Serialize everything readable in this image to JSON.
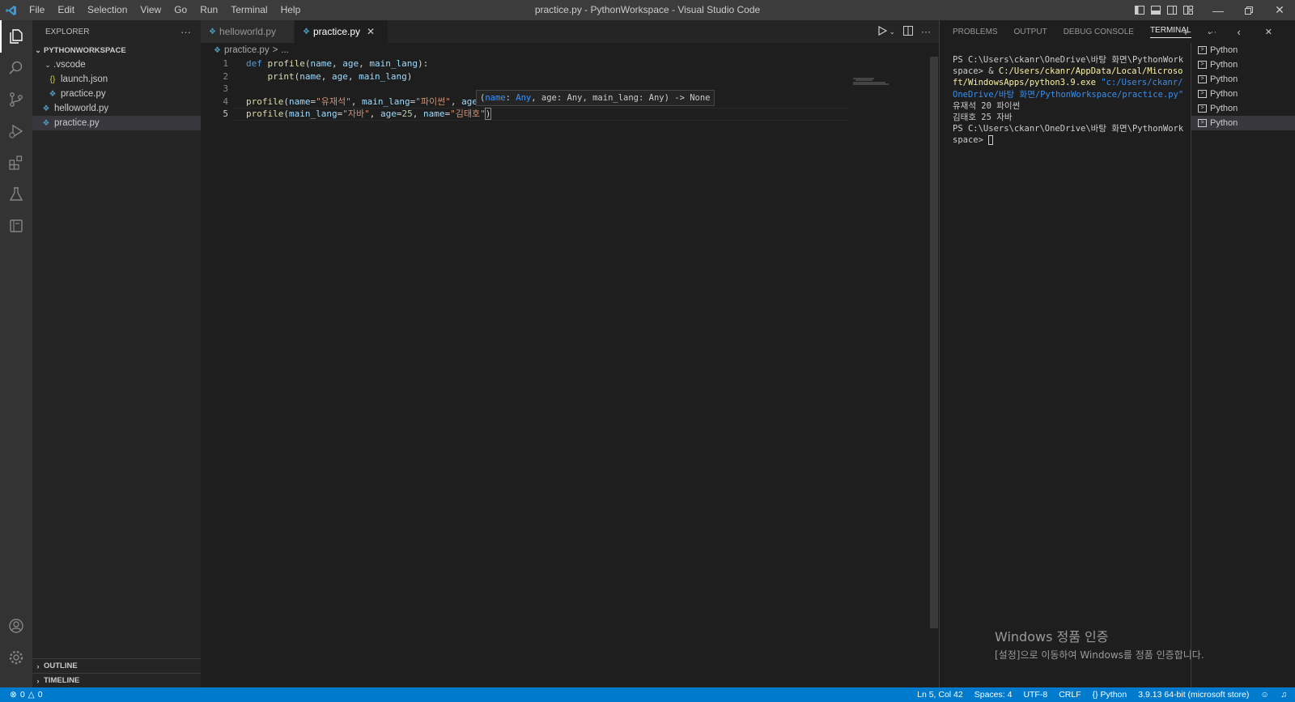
{
  "window": {
    "title": "practice.py - PythonWorkspace - Visual Studio Code"
  },
  "menu": [
    "File",
    "Edit",
    "Selection",
    "View",
    "Go",
    "Run",
    "Terminal",
    "Help"
  ],
  "explorer": {
    "header": "EXPLORER",
    "more": "···",
    "root": "PYTHONWORKSPACE",
    "folder_vscode": ".vscode",
    "launch_json": "launch.json",
    "practice_nested": "practice.py",
    "helloworld": "helloworld.py",
    "practice": "practice.py",
    "outline": "OUTLINE",
    "timeline": "TIMELINE"
  },
  "tabs": [
    {
      "label": "helloworld.py"
    },
    {
      "label": "practice.py"
    }
  ],
  "breadcrumb": {
    "file": "practice.py",
    "sep": ">",
    "more": "..."
  },
  "code": {
    "lines": [
      "1",
      "2",
      "3",
      "4",
      "5"
    ],
    "l1": {
      "def": "def ",
      "fn": "profile",
      "p1": "(",
      "a": "name",
      "c1": ", ",
      "b": "age",
      "c2": ", ",
      "c": "main_lang",
      "p2": "):"
    },
    "l2": {
      "ind": "    ",
      "fn": "print",
      "p1": "(",
      "a": "name",
      "c1": ", ",
      "b": "age",
      "c2": ", ",
      "c": "main_lang",
      "p2": ")"
    },
    "l4": {
      "fn": "profile",
      "p1": "(",
      "a": "name",
      "e1": "=",
      "s1": "\"유재석\"",
      "c1": ", ",
      "b": "main_lang",
      "e2": "=",
      "s2": "\"파이썬\"",
      "c2": ", ",
      "c": "age"
    },
    "l5": {
      "fn": "profile",
      "p1": "(",
      "a": "main_lang",
      "e1": "=",
      "s1": "\"자바\"",
      "c1": ", ",
      "b": "age",
      "e2": "=",
      "n": "25",
      "c2": ", ",
      "c": "name",
      "e3": "=",
      "s2": "\"김태호\"",
      "p2": ")"
    }
  },
  "hint": {
    "open": "(",
    "name": "name",
    "sep1": ": ",
    "any1": "Any",
    "rest": ", age: Any, main_lang: Any) -> None"
  },
  "panel": {
    "tabs": [
      "PROBLEMS",
      "OUTPUT",
      "DEBUG CONSOLE",
      "TERMINAL"
    ],
    "more": "···",
    "terminal": {
      "l1": "PS C:\\Users\\ckanr\\OneDrive\\바탕 화면\\PythonWorkspace> & ",
      "exe": "C:/Users/ckanr/AppData/Local/Microsoft/WindowsApps/python3.9.exe",
      "space": " ",
      "arg": "\"c:/Users/ckanr/OneDrive/바탕 화면/PythonWorkspace/practice.py\"",
      "out1": "유재석 20 파이썬",
      "out2": "김태호 25 자바",
      "prompt": "PS C:\\Users\\ckanr\\OneDrive\\바탕 화면\\PythonWorkspace> "
    },
    "terminal_list": [
      "Python",
      "Python",
      "Python",
      "Python",
      "Python",
      "Python"
    ]
  },
  "watermark": {
    "title": "Windows 정품 인증",
    "sub": "[설정]으로 이동하여 Windows를 정품 인증합니다."
  },
  "status": {
    "errors": "0",
    "warnings": "0",
    "position": "Ln 5, Col 42",
    "spaces": "Spaces: 4",
    "encoding": "UTF-8",
    "eol": "CRLF",
    "language": "Python",
    "interpreter": "3.9.13 64-bit (microsoft store)"
  },
  "colors": {
    "accent": "#007acc",
    "activity_bg": "#333333",
    "sidebar_bg": "#252526",
    "editor_bg": "#1e1e1e"
  }
}
